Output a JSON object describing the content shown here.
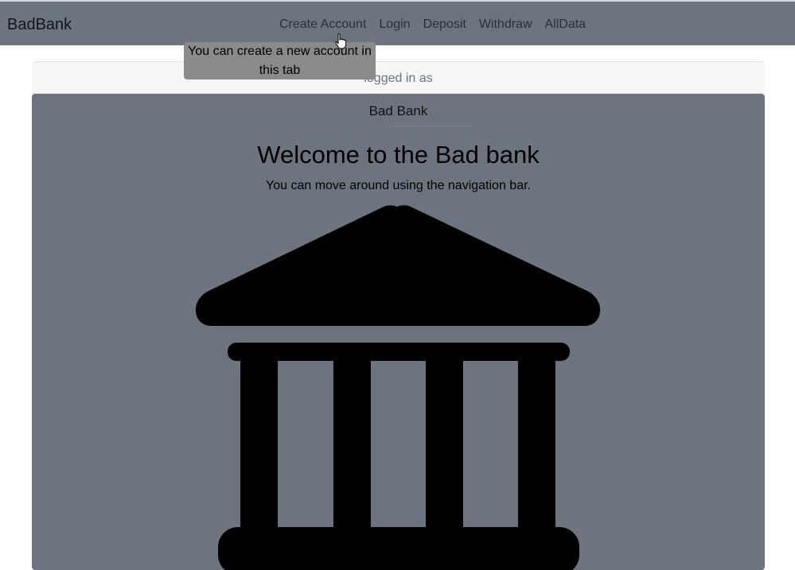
{
  "navbar": {
    "brand": "BadBank",
    "links": [
      {
        "label": "Create Account"
      },
      {
        "label": "Login"
      },
      {
        "label": "Deposit"
      },
      {
        "label": "Withdraw"
      },
      {
        "label": "AllData"
      }
    ]
  },
  "tooltip": {
    "text": "You can create a new account in this tab"
  },
  "card": {
    "header": "logged in as",
    "title": "Bad Bank",
    "heading": "Welcome to the Bad bank",
    "subtext": "You can move around using the navigation bar.",
    "image_icon": "bank-building-icon"
  },
  "colors": {
    "navbar_bg": "#6c757d",
    "card_bg": "#6c757d",
    "tooltip_bg": "#8a8a8a"
  }
}
